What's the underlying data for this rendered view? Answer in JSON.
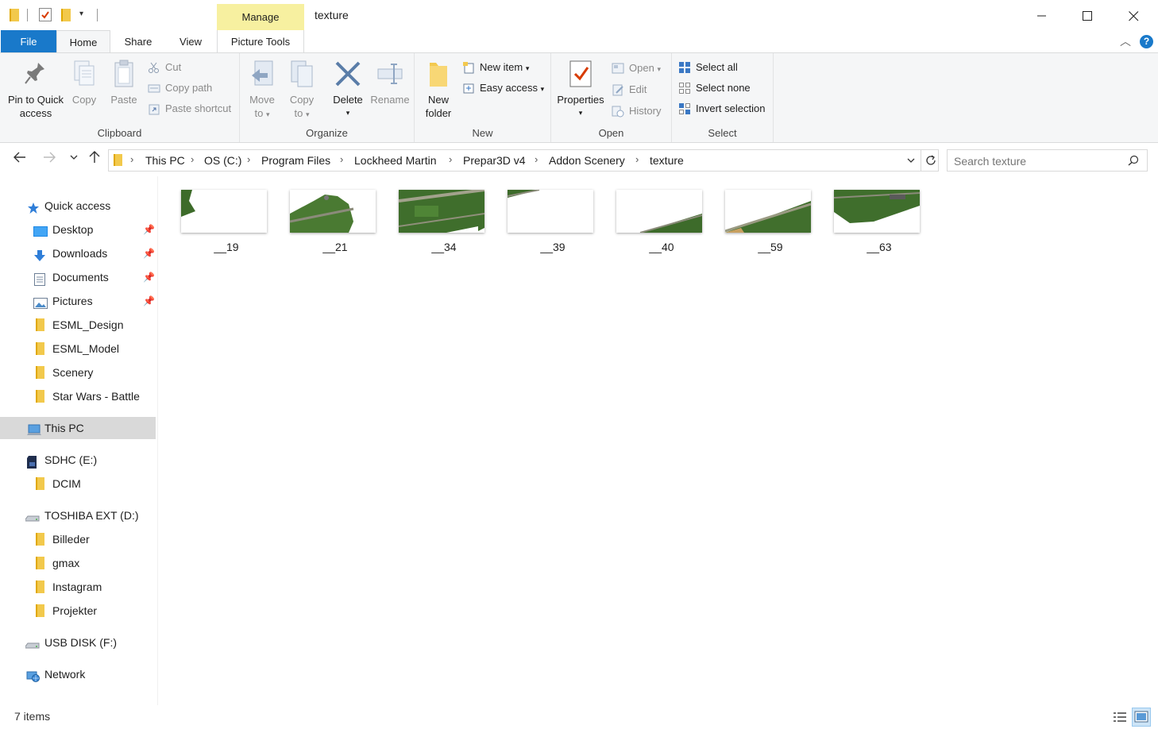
{
  "window": {
    "title": "texture",
    "manage_label": "Manage",
    "minimize": "—",
    "maximize": "☐",
    "close": "✕"
  },
  "tabs": {
    "file": "File",
    "home": "Home",
    "share": "Share",
    "view": "View",
    "picture_tools": "Picture Tools"
  },
  "ribbon": {
    "clipboard": {
      "label": "Clipboard",
      "pin_line1": "Pin to Quick",
      "pin_line2": "access",
      "copy": "Copy",
      "paste": "Paste",
      "cut": "Cut",
      "copy_path": "Copy path",
      "paste_shortcut": "Paste shortcut"
    },
    "organize": {
      "label": "Organize",
      "move_line1": "Move",
      "move_line2": "to",
      "copy_line1": "Copy",
      "copy_line2": "to",
      "delete": "Delete",
      "rename": "Rename"
    },
    "new": {
      "label": "New",
      "folder_line1": "New",
      "folder_line2": "folder",
      "new_item": "New item",
      "easy_access": "Easy access"
    },
    "open": {
      "label": "Open",
      "properties": "Properties",
      "open": "Open",
      "edit": "Edit",
      "history": "History"
    },
    "select": {
      "label": "Select",
      "select_all": "Select all",
      "select_none": "Select none",
      "invert_selection": "Invert selection"
    }
  },
  "address": {
    "crumbs": [
      "This PC",
      "OS (C:)",
      "Program Files",
      "Lockheed Martin",
      "Prepar3D v4",
      "Addon Scenery",
      "texture"
    ],
    "search_placeholder": "Search texture"
  },
  "nav": {
    "quick_access": "Quick access",
    "pinned": [
      "Desktop",
      "Downloads",
      "Documents",
      "Pictures"
    ],
    "folders": [
      "ESML_Design",
      "ESML_Model",
      "Scenery",
      "Star Wars - Battle"
    ],
    "this_pc": "This PC",
    "sdhc": "SDHC (E:)",
    "sdhc_children": [
      "DCIM"
    ],
    "toshiba": "TOSHIBA EXT (D:)",
    "toshiba_children": [
      "Billeder",
      "gmax",
      "Instagram",
      "Projekter"
    ],
    "usb": "USB DISK (F:)",
    "network": "Network"
  },
  "files": [
    "__19",
    "__21",
    "__34",
    "__39",
    "__40",
    "__59",
    "__63"
  ],
  "status": {
    "count": "7 items"
  },
  "colors": {
    "accent": "#1979ca",
    "manage_highlight": "#f7f0a0",
    "ribbon_bg": "#f5f6f7",
    "selected_nav": "#d9d9d9",
    "grass": "#3d6b2a"
  }
}
